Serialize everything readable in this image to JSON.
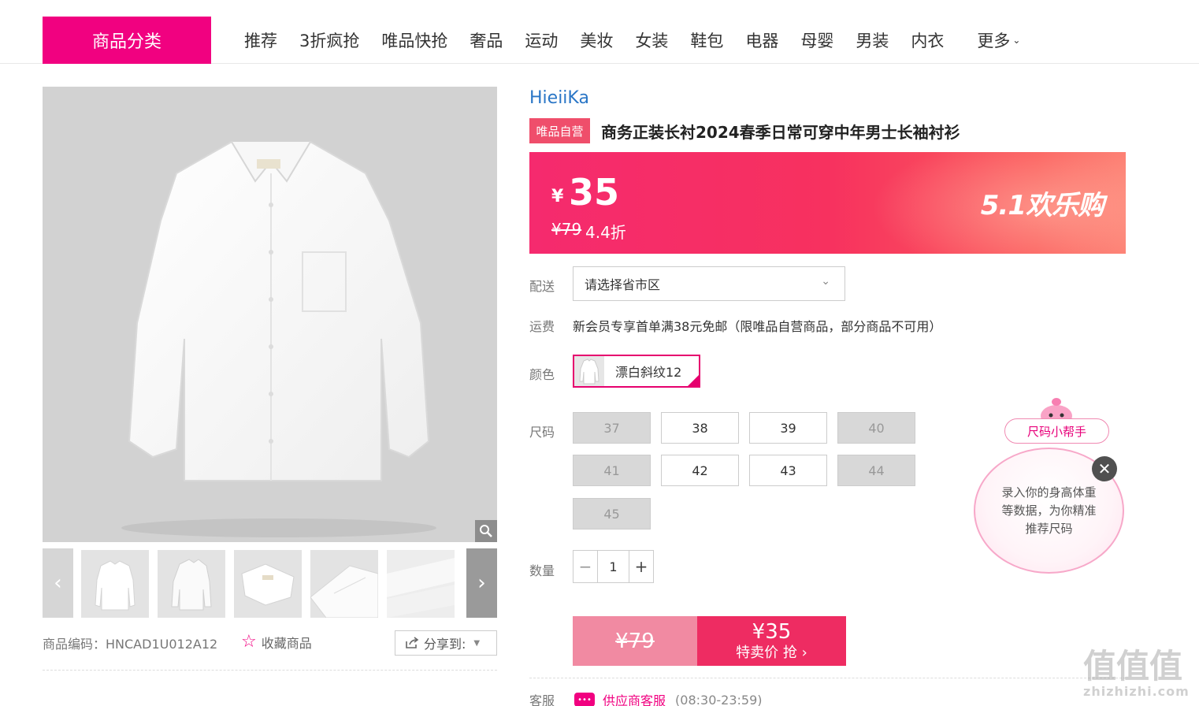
{
  "nav": {
    "category_label": "商品分类",
    "items": [
      "推荐",
      "3折疯抢",
      "唯品快抢",
      "奢品",
      "运动",
      "美妆",
      "女装",
      "鞋包",
      "电器",
      "母婴",
      "男装",
      "内衣"
    ],
    "more_label": "更多"
  },
  "gallery": {
    "thumbs_count_visible": 5,
    "product_code_label": "商品编码：HNCAD1U012A12",
    "favorite_label": "收藏商品",
    "share_label": "分享到:"
  },
  "product": {
    "brand": "HieiiKa",
    "self_badge": "唯品自营",
    "title": "商务正装长衬2024春季日常可穿中年男士长袖衬衫"
  },
  "price": {
    "currency": "¥",
    "sale": "35",
    "original": "¥79",
    "discount": "4.4折",
    "promo": "5.1欢乐购"
  },
  "delivery": {
    "label": "配送",
    "placeholder": "请选择省市区"
  },
  "shipping": {
    "label": "运费",
    "text": "新会员专享首单满38元免邮（限唯品自营商品，部分商品不可用）"
  },
  "color": {
    "label": "颜色",
    "selected": "漂白斜纹12"
  },
  "size": {
    "label": "尺码",
    "options": [
      {
        "value": "37",
        "available": false
      },
      {
        "value": "38",
        "available": true
      },
      {
        "value": "39",
        "available": true
      },
      {
        "value": "40",
        "available": false
      },
      {
        "value": "41",
        "available": false
      },
      {
        "value": "42",
        "available": true
      },
      {
        "value": "43",
        "available": true
      },
      {
        "value": "44",
        "available": false
      },
      {
        "value": "45",
        "available": false
      }
    ]
  },
  "quantity": {
    "label": "数量",
    "value": "1",
    "minus": "−",
    "plus": "+"
  },
  "buy": {
    "original": "¥79",
    "sale": "¥35",
    "cta": "特卖价 抢 ›"
  },
  "service": {
    "label": "客服",
    "link": "供应商客服",
    "hours": "(08:30-23:59)"
  },
  "size_helper": {
    "title": "尺码小帮手",
    "text": "录入你的身高体重等数据，为你精准推荐尺码"
  },
  "watermark": {
    "text": "值值值",
    "domain": "zhizhizhi.com"
  },
  "colors": {
    "accent": "#f10180",
    "price_banner": "#f52a6e",
    "brand_link": "#2a76c6"
  }
}
